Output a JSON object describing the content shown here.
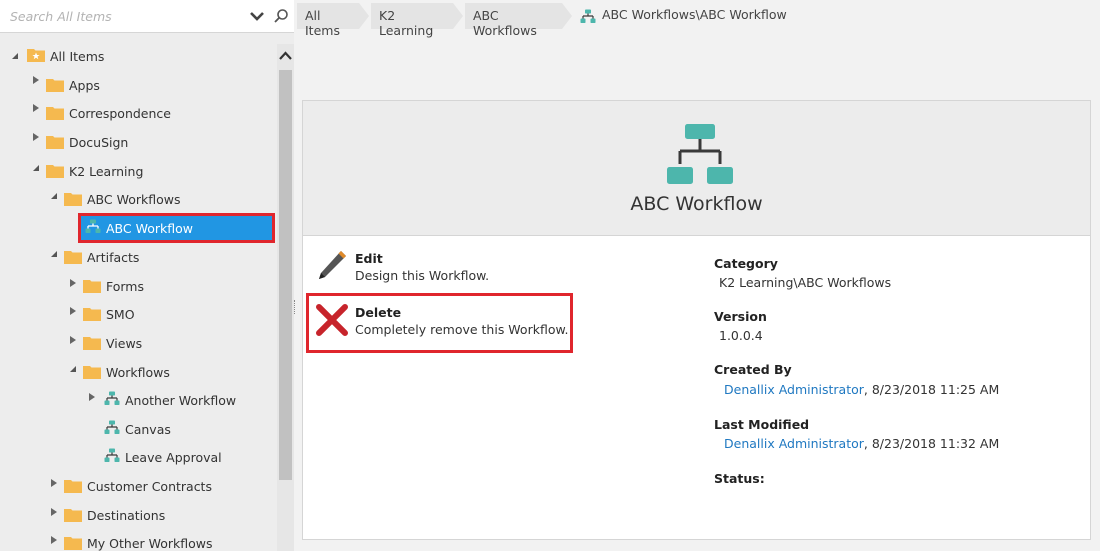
{
  "search": {
    "placeholder": "Search All Items"
  },
  "tree": {
    "root": "All Items",
    "apps": "Apps",
    "correspondence": "Correspondence",
    "docusign": "DocuSign",
    "k2learning": "K2 Learning",
    "abc_workflows": "ABC Workflows",
    "abc_workflow": "ABC Workflow",
    "artifacts": "Artifacts",
    "forms": "Forms",
    "smo": "SMO",
    "views": "Views",
    "workflows": "Workflows",
    "another_workflow": "Another Workflow",
    "canvas": "Canvas",
    "leave_approval": "Leave Approval",
    "customer_contracts": "Customer Contracts",
    "destinations": "Destinations",
    "my_other_workflows": "My Other Workflows"
  },
  "breadcrumb": {
    "items": [
      "All Items",
      "K2 Learning",
      "ABC Workflows"
    ],
    "current": "ABC Workflows\\ABC Workflow"
  },
  "card": {
    "title": "ABC Workflow",
    "actions": {
      "edit": {
        "title": "Edit",
        "desc": "Design this Workflow."
      },
      "delete": {
        "title": "Delete",
        "desc": "Completely remove this Workflow."
      }
    },
    "props": {
      "category_label": "Category",
      "category_value": "K2 Learning\\ABC Workflows",
      "version_label": "Version",
      "version_value": "1.0.0.4",
      "created_label": "Created By",
      "created_user": "Denallix Administrator",
      "created_date": ", 8/23/2018 11:25 AM",
      "modified_label": "Last Modified",
      "modified_user": "Denallix Administrator",
      "modified_date": ", 8/23/2018 11:32 AM",
      "status_label": "Status:"
    }
  },
  "colors": {
    "accent": "#2196e3",
    "highlight": "#e0262d",
    "workflow_icon": "#4db6ac",
    "folder": "#f5b94f",
    "link": "#1f78c1"
  }
}
